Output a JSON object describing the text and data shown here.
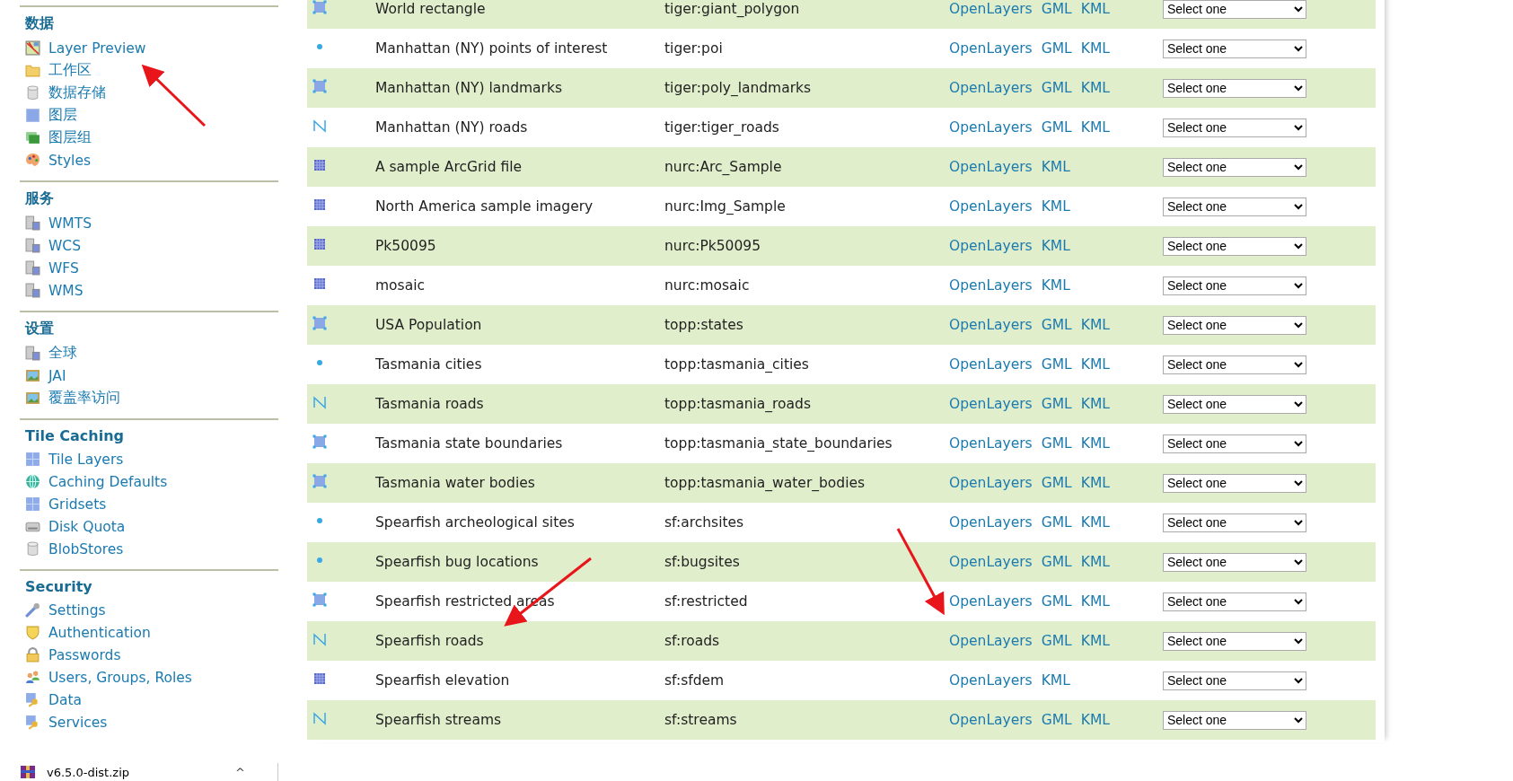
{
  "sidebar": {
    "sections": [
      {
        "title": "数据",
        "items": [
          {
            "label": "Layer Preview",
            "kind": "map"
          },
          {
            "label": "工作区",
            "kind": "folder"
          },
          {
            "label": "数据存储",
            "kind": "database"
          },
          {
            "label": "图层",
            "kind": "layer"
          },
          {
            "label": "图层组",
            "kind": "layergroup"
          },
          {
            "label": "Styles",
            "kind": "palette"
          }
        ]
      },
      {
        "title": "服务",
        "items": [
          {
            "label": "WMTS",
            "kind": "server"
          },
          {
            "label": "WCS",
            "kind": "server"
          },
          {
            "label": "WFS",
            "kind": "server"
          },
          {
            "label": "WMS",
            "kind": "server"
          }
        ]
      },
      {
        "title": "设置",
        "items": [
          {
            "label": "全球",
            "kind": "server"
          },
          {
            "label": "JAI",
            "kind": "image"
          },
          {
            "label": "覆盖率访问",
            "kind": "image"
          }
        ]
      },
      {
        "title": "Tile Caching",
        "items": [
          {
            "label": "Tile Layers",
            "kind": "grid"
          },
          {
            "label": "Caching Defaults",
            "kind": "globe"
          },
          {
            "label": "Gridsets",
            "kind": "grid"
          },
          {
            "label": "Disk Quota",
            "kind": "disk"
          },
          {
            "label": "BlobStores",
            "kind": "database"
          }
        ]
      },
      {
        "title": "Security",
        "items": [
          {
            "label": "Settings",
            "kind": "wrench"
          },
          {
            "label": "Authentication",
            "kind": "shield"
          },
          {
            "label": "Passwords",
            "kind": "lock"
          },
          {
            "label": "Users, Groups, Roles",
            "kind": "users"
          },
          {
            "label": "Data",
            "kind": "key"
          },
          {
            "label": "Services",
            "kind": "key"
          }
        ]
      }
    ]
  },
  "layers": [
    {
      "kind": "polygon",
      "title": "World rectangle",
      "name": "tiger:giant_polygon",
      "links": [
        "OpenLayers",
        "GML",
        "KML"
      ],
      "select": "Select one"
    },
    {
      "kind": "point",
      "title": "Manhattan (NY) points of interest",
      "name": "tiger:poi",
      "links": [
        "OpenLayers",
        "GML",
        "KML"
      ],
      "select": "Select one"
    },
    {
      "kind": "polygon",
      "title": "Manhattan (NY) landmarks",
      "name": "tiger:poly_landmarks",
      "links": [
        "OpenLayers",
        "GML",
        "KML"
      ],
      "select": "Select one"
    },
    {
      "kind": "line",
      "title": "Manhattan (NY) roads",
      "name": "tiger:tiger_roads",
      "links": [
        "OpenLayers",
        "GML",
        "KML"
      ],
      "select": "Select one"
    },
    {
      "kind": "raster",
      "title": "A sample ArcGrid file",
      "name": "nurc:Arc_Sample",
      "links": [
        "OpenLayers",
        "KML"
      ],
      "select": "Select one"
    },
    {
      "kind": "raster",
      "title": "North America sample imagery",
      "name": "nurc:Img_Sample",
      "links": [
        "OpenLayers",
        "KML"
      ],
      "select": "Select one"
    },
    {
      "kind": "raster",
      "title": "Pk50095",
      "name": "nurc:Pk50095",
      "links": [
        "OpenLayers",
        "KML"
      ],
      "select": "Select one"
    },
    {
      "kind": "raster",
      "title": "mosaic",
      "name": "nurc:mosaic",
      "links": [
        "OpenLayers",
        "KML"
      ],
      "select": "Select one"
    },
    {
      "kind": "polygon",
      "title": "USA Population",
      "name": "topp:states",
      "links": [
        "OpenLayers",
        "GML",
        "KML"
      ],
      "select": "Select one"
    },
    {
      "kind": "point",
      "title": "Tasmania cities",
      "name": "topp:tasmania_cities",
      "links": [
        "OpenLayers",
        "GML",
        "KML"
      ],
      "select": "Select one"
    },
    {
      "kind": "line",
      "title": "Tasmania roads",
      "name": "topp:tasmania_roads",
      "links": [
        "OpenLayers",
        "GML",
        "KML"
      ],
      "select": "Select one"
    },
    {
      "kind": "polygon",
      "title": "Tasmania state boundaries",
      "name": "topp:tasmania_state_boundaries",
      "links": [
        "OpenLayers",
        "GML",
        "KML"
      ],
      "select": "Select one"
    },
    {
      "kind": "polygon",
      "title": "Tasmania water bodies",
      "name": "topp:tasmania_water_bodies",
      "links": [
        "OpenLayers",
        "GML",
        "KML"
      ],
      "select": "Select one"
    },
    {
      "kind": "point",
      "title": "Spearfish archeological sites",
      "name": "sf:archsites",
      "links": [
        "OpenLayers",
        "GML",
        "KML"
      ],
      "select": "Select one"
    },
    {
      "kind": "point",
      "title": "Spearfish bug locations",
      "name": "sf:bugsites",
      "links": [
        "OpenLayers",
        "GML",
        "KML"
      ],
      "select": "Select one"
    },
    {
      "kind": "polygon",
      "title": "Spearfish restricted areas",
      "name": "sf:restricted",
      "links": [
        "OpenLayers",
        "GML",
        "KML"
      ],
      "select": "Select one"
    },
    {
      "kind": "line",
      "title": "Spearfish roads",
      "name": "sf:roads",
      "links": [
        "OpenLayers",
        "GML",
        "KML"
      ],
      "select": "Select one"
    },
    {
      "kind": "raster",
      "title": "Spearfish elevation",
      "name": "sf:sfdem",
      "links": [
        "OpenLayers",
        "KML"
      ],
      "select": "Select one"
    },
    {
      "kind": "line",
      "title": "Spearfish streams",
      "name": "sf:streams",
      "links": [
        "OpenLayers",
        "GML",
        "KML"
      ],
      "select": "Select one"
    }
  ],
  "download_bar": {
    "file": "v6.5.0-dist.zip",
    "caret": "^"
  }
}
